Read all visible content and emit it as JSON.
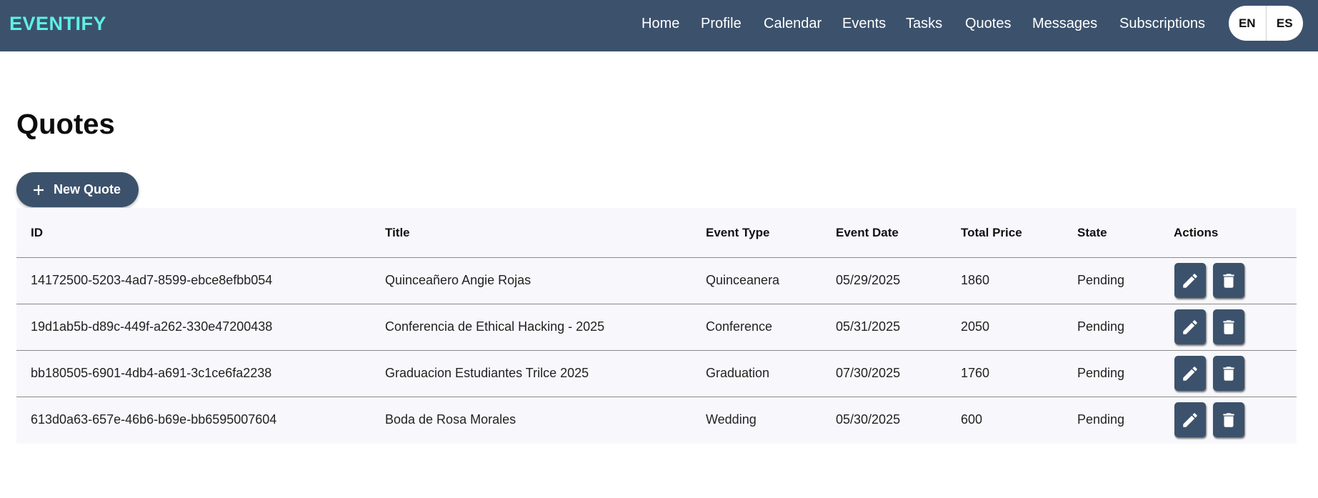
{
  "header": {
    "brand": "EVENTIFY",
    "nav": [
      "Home",
      "Profile",
      "Calendar",
      "Events",
      "Tasks",
      "Quotes",
      "Messages",
      "Subscriptions"
    ],
    "languages": [
      "EN",
      "ES"
    ]
  },
  "page": {
    "title": "Quotes",
    "new_button_label": "New Quote"
  },
  "table": {
    "columns": [
      "ID",
      "Title",
      "Event Type",
      "Event Date",
      "Total Price",
      "State",
      "Actions"
    ],
    "rows": [
      {
        "id": "14172500-5203-4ad7-8599-ebce8efbb054",
        "title": "Quinceañero Angie Rojas",
        "event_type": "Quinceanera",
        "event_date": "05/29/2025",
        "total_price": "1860",
        "state": "Pending"
      },
      {
        "id": "19d1ab5b-d89c-449f-a262-330e47200438",
        "title": "Conferencia de Ethical Hacking - 2025",
        "event_type": "Conference",
        "event_date": "05/31/2025",
        "total_price": "2050",
        "state": "Pending"
      },
      {
        "id": "bb180505-6901-4db4-a691-3c1ce6fa2238",
        "title": "Graduacion Estudiantes Trilce 2025",
        "event_type": "Graduation",
        "event_date": "07/30/2025",
        "total_price": "1760",
        "state": "Pending"
      },
      {
        "id": "613d0a63-657e-46b6-b69e-bb6595007604",
        "title": "Boda de Rosa Morales",
        "event_type": "Wedding",
        "event_date": "05/30/2025",
        "total_price": "600",
        "state": "Pending"
      }
    ]
  },
  "icons": {
    "add": "plus-icon",
    "edit": "pencil-icon",
    "delete": "trash-icon"
  },
  "colors": {
    "header_bg": "#3c526c",
    "brand": "#5ef0e6",
    "button_bg": "#3c526c",
    "table_bg": "#f8f8fc"
  }
}
